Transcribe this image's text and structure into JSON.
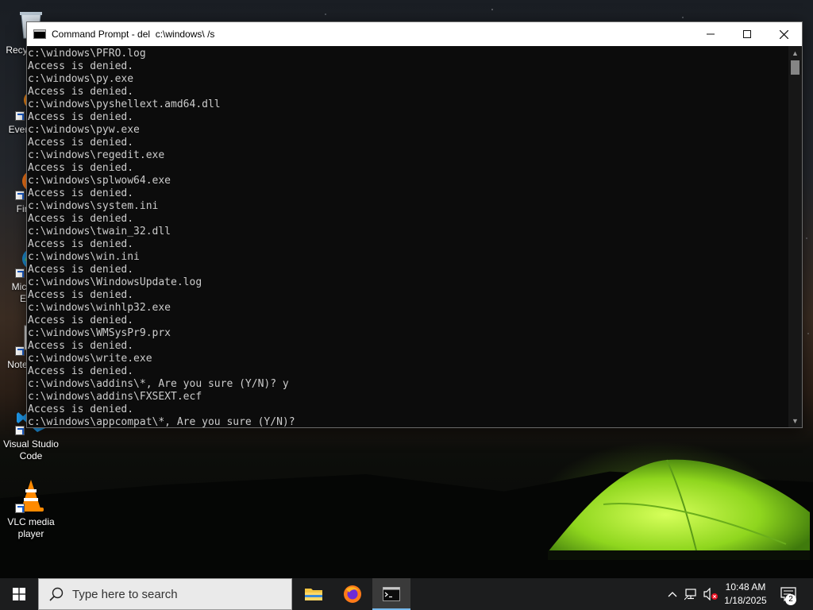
{
  "desktop": {
    "icons": [
      {
        "label": "Recycle Bin",
        "icon": "recycle-bin-icon"
      },
      {
        "label": "Everything",
        "icon": "everything-icon"
      },
      {
        "label": "Firefox",
        "icon": "firefox-icon"
      },
      {
        "label": "Microsoft Edge",
        "icon": "edge-icon"
      },
      {
        "label": "Notepad++",
        "icon": "notepad-plus-plus-icon"
      },
      {
        "label": "Visual Studio Code",
        "icon": "vscode-icon"
      },
      {
        "label": "VLC media player",
        "icon": "vlc-icon"
      }
    ]
  },
  "window": {
    "title": "Command Prompt - del  c:\\windows\\ /s",
    "controls": {
      "minimize": "minimize",
      "maximize": "maximize",
      "close": "close"
    },
    "console_lines": [
      "c:\\windows\\PFRO.log",
      "Access is denied.",
      "c:\\windows\\py.exe",
      "Access is denied.",
      "c:\\windows\\pyshellext.amd64.dll",
      "Access is denied.",
      "c:\\windows\\pyw.exe",
      "Access is denied.",
      "c:\\windows\\regedit.exe",
      "Access is denied.",
      "c:\\windows\\splwow64.exe",
      "Access is denied.",
      "c:\\windows\\system.ini",
      "Access is denied.",
      "c:\\windows\\twain_32.dll",
      "Access is denied.",
      "c:\\windows\\win.ini",
      "Access is denied.",
      "c:\\windows\\WindowsUpdate.log",
      "Access is denied.",
      "c:\\windows\\winhlp32.exe",
      "Access is denied.",
      "c:\\windows\\WMSysPr9.prx",
      "Access is denied.",
      "c:\\windows\\write.exe",
      "Access is denied.",
      "c:\\windows\\addins\\*, Are you sure (Y/N)? y",
      "c:\\windows\\addins\\FXSEXT.ecf",
      "Access is denied.",
      "c:\\windows\\appcompat\\*, Are you sure (Y/N)?"
    ]
  },
  "taskbar": {
    "search_placeholder": "Type here to search",
    "apps": [
      "file-explorer",
      "firefox",
      "command-prompt"
    ],
    "clock_time": "10:48 AM",
    "clock_date": "1/18/2025",
    "notification_count": "2"
  },
  "colors": {
    "console_bg": "#0c0c0c",
    "console_text": "#cccccc",
    "taskbar_bg": "#1c1d1e",
    "accent": "#76b9ed",
    "tent_green": "#9be22a"
  }
}
